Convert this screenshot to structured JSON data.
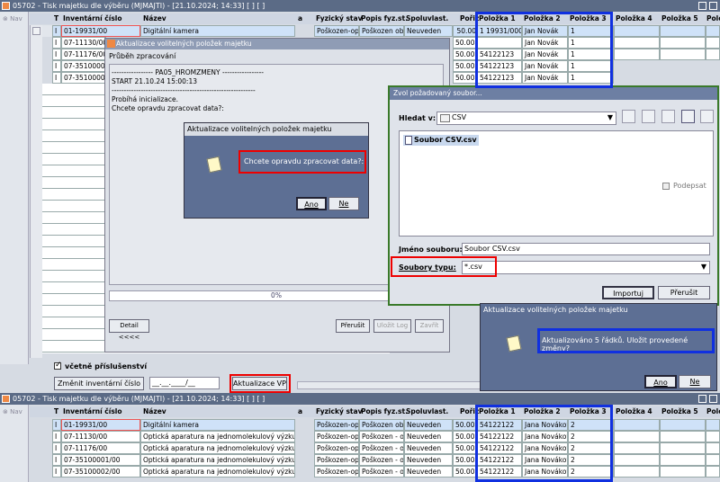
{
  "top_window": {
    "title": "05702 - Tisk majetku dle výběru (MJMAJTI) - [21.10.2024; 14:33]  [ ]  [ ]",
    "nav_label": "Nav",
    "columns": [
      "T",
      "Inventární číslo",
      "Název",
      "a",
      "Fyzický stav",
      "Popis fyz.st.",
      "Spoluvlast.",
      "Pořiz",
      "Položka 1",
      "Položka 2",
      "Položka 3",
      "Položka 4",
      "Položka 5",
      "Polož"
    ],
    "rows": [
      {
        "t": "I",
        "inv": "01-19931/00",
        "nazev": "Digitální kamera",
        "fyz": "Poškozen-opr",
        "popis": "Poškozen obj",
        "spol": "Neuveden",
        "por": "50.00",
        "p1": "1 19931/000",
        "p2": "Jan Novák",
        "p3": "1"
      },
      {
        "t": "I",
        "inv": "07-11130/00",
        "nazev": "",
        "fyz": "",
        "popis": "",
        "spol": "",
        "por": "50.00",
        "p1": "",
        "p2": "Jan Novák",
        "p3": "1"
      },
      {
        "t": "I",
        "inv": "07-11176/00",
        "nazev": "",
        "fyz": "",
        "popis": "",
        "spol": "",
        "por": "50.00",
        "p1": "54122123",
        "p2": "Jan Novák",
        "p3": "1"
      },
      {
        "t": "I",
        "inv": "07-35100001",
        "nazev": "",
        "fyz": "",
        "popis": "",
        "spol": "",
        "por": "50.00",
        "p1": "54122123",
        "p2": "Jan Novák",
        "p3": "1"
      },
      {
        "t": "I",
        "inv": "07-35100002",
        "nazev": "",
        "fyz": "",
        "popis": "",
        "spol": "",
        "por": "50.00",
        "p1": "54122123",
        "p2": "Jan Novák",
        "p3": "1"
      }
    ],
    "checkbox_label": "včetně příslušenství",
    "change_button": "Změnit inventární číslo",
    "date_value": "__.__.____/__",
    "update_button": "Aktualizace VP"
  },
  "progress_window": {
    "title": "Aktualizace volitelných položek majetku",
    "subtitle": "Průběh zpracování",
    "log_lines": [
      "----------------- PA05_HROMZMENY -----------------",
      "START 21.10.24 15:00:13",
      "-----------------------------------------------------------",
      "Probíhá inicializace.",
      "Chcete opravdu zpracovat data?:"
    ],
    "progress": "0%",
    "detail_button": "Detail <<<<",
    "stop_button": "Přerušit",
    "save_log_button": "Uložit Log",
    "close_button": "Zavřít"
  },
  "confirm_dialog": {
    "title": "Aktualizace volitelných položek majetku",
    "message": "Chcete opravdu zpracovat data?:",
    "yes": "Ano",
    "no": "Ne"
  },
  "file_dialog": {
    "title": "Zvol požadovaný soubor...",
    "look_in_label": "Hledat v:",
    "look_in_value": "CSV",
    "file_item": "Soubor CSV.csv",
    "readonly_label": "Podepsat",
    "filename_label": "Jméno souboru:",
    "filename_value": "Soubor CSV.csv",
    "filetype_label": "Soubory typu:",
    "filetype_value": "*.csv",
    "import_button": "Importuj",
    "cancel_button": "Přerušit"
  },
  "result_dialog": {
    "title": "Aktualizace volitelných položek majetku",
    "message": "Aktualizováno 5 řádků. Uložit provedené změny?",
    "yes": "Ano",
    "no": "Ne"
  },
  "bottom_window": {
    "title": "05702 - Tisk majetku dle výběru (MJMAJTI) - [21.10.2024; 14:33]  [ ]  [ ]",
    "nav_label": "Nav",
    "rows": [
      {
        "t": "I",
        "inv": "01-19931/00",
        "nazev": "Digitální kamera",
        "fyz": "Poškozen-opr",
        "popis": "Poškozen obj",
        "spol": "Neuveden",
        "por": "50.00",
        "p1": "54122122",
        "p2": "Jana Nováková",
        "p3": "2"
      },
      {
        "t": "I",
        "inv": "07-11130/00",
        "nazev": "Optická aparatura na jednomolekulový výzkum+fl",
        "fyz": "Poškozen-opr",
        "popis": "Poškozen - obj",
        "spol": "Neuveden",
        "por": "50.00",
        "p1": "54122122",
        "p2": "Jana Nováková",
        "p3": "2"
      },
      {
        "t": "I",
        "inv": "07-11176/00",
        "nazev": "Optická aparatura na jednomolekulový výzkum+fl",
        "fyz": "Poškozen-opr",
        "popis": "Poškozen - obj",
        "spol": "Neuveden",
        "por": "50.00",
        "p1": "54122122",
        "p2": "Jana Nováková",
        "p3": "2"
      },
      {
        "t": "I",
        "inv": "07-35100001/00",
        "nazev": "Optická aparatura na jednomolekulový výzkum+fl",
        "fyz": "Poškozen-opr",
        "popis": "Poškozen - obj",
        "spol": "Neuveden",
        "por": "50.00",
        "p1": "54122122",
        "p2": "Jana Nováková",
        "p3": "2"
      },
      {
        "t": "I",
        "inv": "07-35100002/00",
        "nazev": "Optická aparatura na jednomolekulový výzkum+fl",
        "fyz": "Poškozen-opr",
        "popis": "Poškozen - obj",
        "spol": "Neuveden",
        "por": "50.00",
        "p1": "54122122",
        "p2": "Jana Nováková",
        "p3": "2"
      }
    ]
  }
}
